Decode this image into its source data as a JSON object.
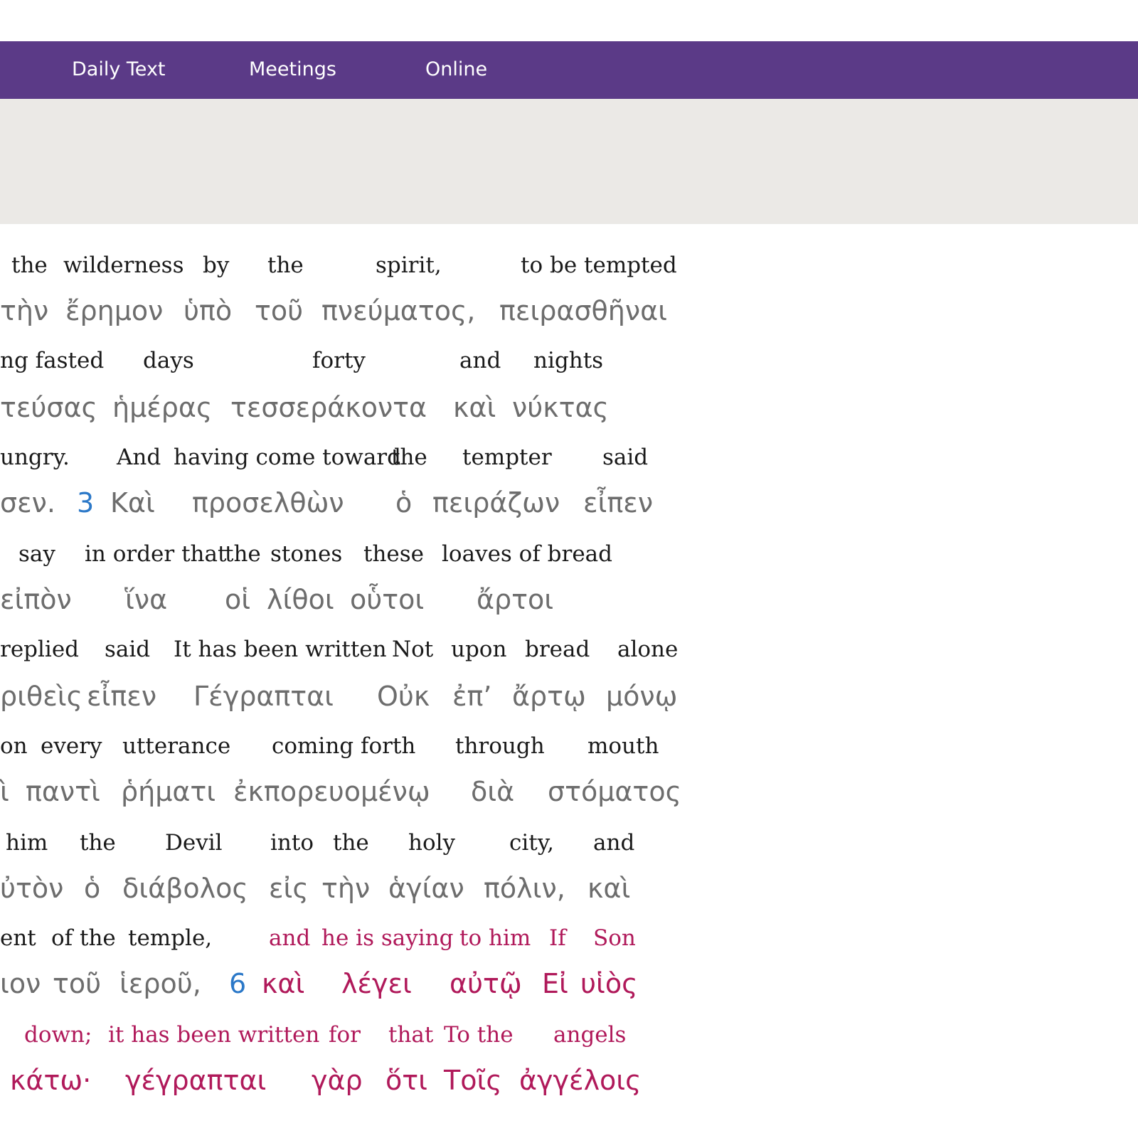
{
  "nav": {
    "items": [
      {
        "label": "Daily Text"
      },
      {
        "label": "Meetings"
      },
      {
        "label": "Online"
      }
    ]
  },
  "colors": {
    "nav_bg": "#5b3a87",
    "banner_bg": "#ebe9e6",
    "english_text": "#1a1a1a",
    "greek_text": "#6d6d6d",
    "words_of_jesus": "#b0195a",
    "verse_number": "#2b78c8"
  },
  "interlinear": {
    "rows": [
      {
        "english": [
          "the",
          "wilderness",
          "by",
          "the",
          "spirit,",
          "to be tempted"
        ],
        "greek": [
          "τὴν",
          "ἔρημον",
          "ὑπὸ",
          "τοῦ",
          "πνεύματος,",
          "πειρασθῆναι"
        ]
      },
      {
        "english": [
          "ng fasted",
          "days",
          "forty",
          "and",
          "nights"
        ],
        "greek": [
          "τεύσας",
          "ἡμέρας",
          "τεσσεράκοντα",
          "καὶ",
          "νύκτας"
        ]
      },
      {
        "english": [
          "ungry.",
          "And",
          "having come toward",
          "the",
          "tempter",
          "said"
        ],
        "verse": "3",
        "greek": [
          "σεν.",
          "Καὶ",
          "προσελθὼν",
          "ὁ",
          "πειράζων",
          "εἶπεν"
        ]
      },
      {
        "english": [
          "say",
          "in order that",
          "the",
          "stones",
          "these",
          "loaves of bread"
        ],
        "greek": [
          "εἰπὸν",
          "ἵνα",
          "οἱ",
          "λίθοι",
          "οὗτοι",
          "ἄρτοι"
        ]
      },
      {
        "english": [
          "replied",
          "said",
          "It has been written",
          "Not",
          "upon",
          "bread",
          "alone"
        ],
        "greek": [
          "ριθεὶς",
          "εἶπεν",
          "Γέγραπται",
          "Οὐκ",
          "ἐπ’",
          "ἄρτῳ",
          "μόνῳ"
        ]
      },
      {
        "english": [
          "on",
          "every",
          "utterance",
          "coming forth",
          "through",
          "mouth"
        ],
        "greek": [
          "ὶ",
          "παντὶ",
          "ῥήματι",
          "ἐκπορευομένῳ",
          "διὰ",
          "στόματος"
        ]
      },
      {
        "english": [
          "him",
          "the",
          "Devil",
          "into",
          "the",
          "holy",
          "city,",
          "and"
        ],
        "greek": [
          "ὐτὸν",
          "ὁ",
          "διάβολος",
          "εἰς",
          "τὴν",
          "ἁγίαν",
          "πόλιν,",
          "καὶ"
        ]
      },
      {
        "english": [
          "ent",
          "of the",
          "temple,"
        ],
        "english_red": [
          "and",
          "he is saying",
          "to him",
          "If",
          "Son"
        ],
        "verse": "6",
        "greek": [
          "ιον",
          "τοῦ",
          "ἱεροῦ,"
        ],
        "greek_red": [
          "καὶ",
          "λέγει",
          "αὐτῷ",
          "Εἰ",
          "υἱὸς"
        ]
      },
      {
        "english_red": [
          "down;",
          "it has been written",
          "for",
          "that",
          "To the",
          "angels"
        ],
        "greek_red": [
          "κάτω·",
          "γέγραπται",
          "γὰρ",
          "ὅτι",
          "Τοῖς",
          "ἀγγέλοις"
        ]
      }
    ]
  }
}
